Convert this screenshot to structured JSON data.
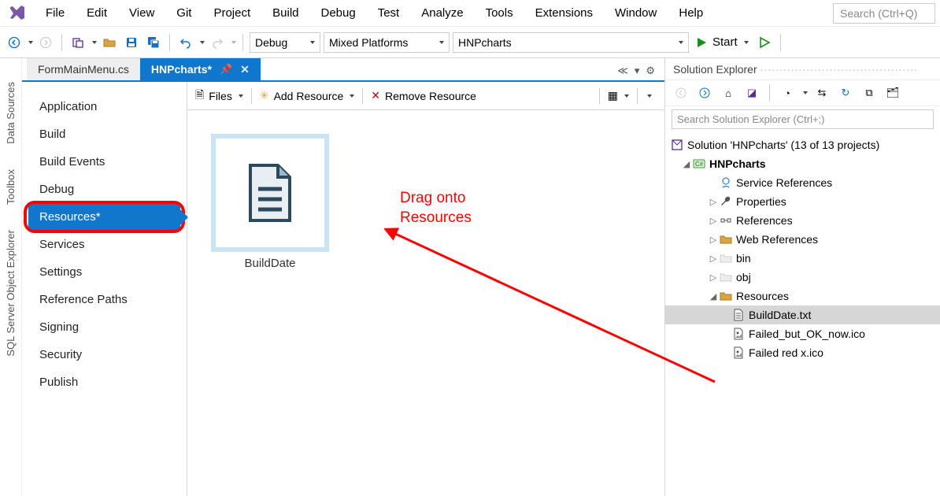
{
  "menubar": {
    "items": [
      "File",
      "Edit",
      "View",
      "Git",
      "Project",
      "Build",
      "Debug",
      "Test",
      "Analyze",
      "Tools",
      "Extensions",
      "Window",
      "Help"
    ],
    "search_placeholder": "Search (Ctrl+Q)"
  },
  "toolbar": {
    "config": "Debug",
    "platform": "Mixed Platforms",
    "startup_project": "HNPcharts",
    "start_label": "Start"
  },
  "left_rails": [
    "Data Sources",
    "Toolbox",
    "SQL Server Object Explorer"
  ],
  "tabs": {
    "items": [
      {
        "label": "FormMainMenu.cs",
        "active": false
      },
      {
        "label": "HNPcharts*",
        "active": true
      }
    ]
  },
  "prop_nav": {
    "items": [
      "Application",
      "Build",
      "Build Events",
      "Debug",
      "Resources*",
      "Services",
      "Settings",
      "Reference Paths",
      "Signing",
      "Security",
      "Publish"
    ],
    "selected_index": 4
  },
  "res_toolbar": {
    "files": "Files",
    "add": "Add Resource",
    "remove": "Remove Resource"
  },
  "resource_items": [
    {
      "name": "BuildDate"
    }
  ],
  "annotation": {
    "line1": "Drag onto",
    "line2": "Resources"
  },
  "solution_explorer": {
    "title": "Solution Explorer",
    "search_placeholder": "Search Solution Explorer (Ctrl+;)",
    "root": "Solution 'HNPcharts' (13 of 13 projects)",
    "project": "HNPcharts",
    "nodes": [
      {
        "kind": "service",
        "label": "Service References",
        "depth": 3,
        "expander": ""
      },
      {
        "kind": "folder",
        "label": "Properties",
        "depth": 3,
        "expander": "▷",
        "icon": "wrench"
      },
      {
        "kind": "folder",
        "label": "References",
        "depth": 3,
        "expander": "▷",
        "icon": "refs"
      },
      {
        "kind": "folder",
        "label": "Web References",
        "depth": 3,
        "expander": "▷",
        "icon": "folder"
      },
      {
        "kind": "folder",
        "label": "bin",
        "depth": 3,
        "expander": "▷",
        "icon": "ghost"
      },
      {
        "kind": "folder",
        "label": "obj",
        "depth": 3,
        "expander": "▷",
        "icon": "ghost"
      },
      {
        "kind": "folder",
        "label": "Resources",
        "depth": 3,
        "expander": "◢",
        "icon": "folder"
      },
      {
        "kind": "file",
        "label": "BuildDate.txt",
        "depth": 4,
        "expander": "",
        "icon": "txt",
        "selected": true
      },
      {
        "kind": "file",
        "label": "Failed_but_OK_now.ico",
        "depth": 4,
        "expander": "",
        "icon": "img"
      },
      {
        "kind": "file",
        "label": "Failed red x.ico",
        "depth": 4,
        "expander": "",
        "icon": "img"
      }
    ]
  }
}
